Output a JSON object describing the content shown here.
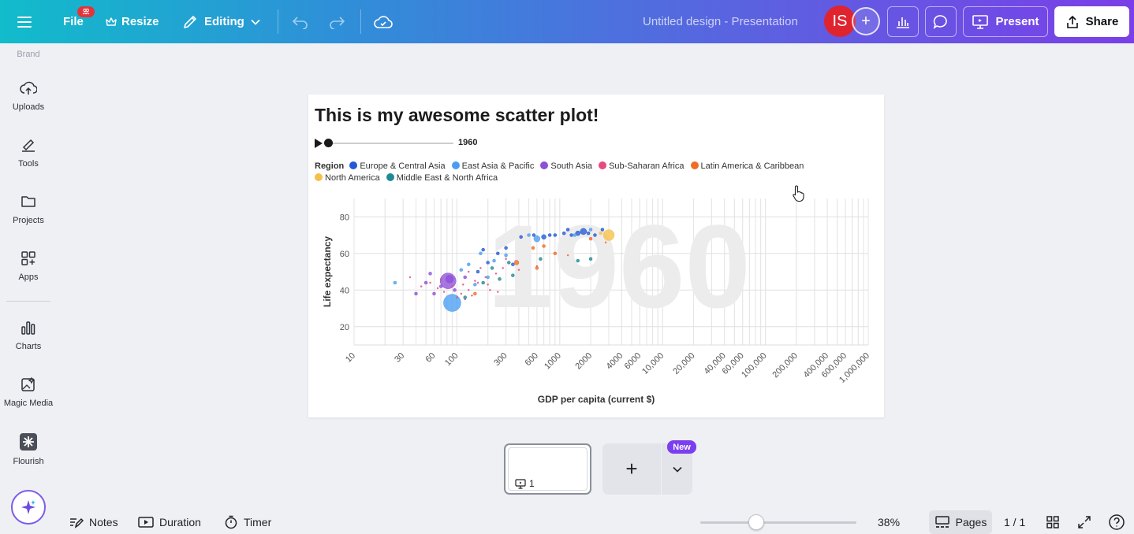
{
  "topbar": {
    "file_label": "File",
    "file_badge": "",
    "resize_label": "Resize",
    "editing_label": "Editing",
    "doc_title": "Untitled design - Presentation",
    "avatar_initials": "IS",
    "present_label": "Present",
    "share_label": "Share"
  },
  "rail": {
    "brand_label": "Brand",
    "items": [
      {
        "label": "Uploads",
        "icon": "cloud-upload-icon"
      },
      {
        "label": "Tools",
        "icon": "pen-tool-icon"
      },
      {
        "label": "Projects",
        "icon": "folder-icon"
      },
      {
        "label": "Apps",
        "icon": "apps-grid-icon"
      },
      {
        "label": "Charts",
        "icon": "bar-chart-icon"
      },
      {
        "label": "Magic Media",
        "icon": "magic-media-icon"
      },
      {
        "label": "Flourish",
        "icon": "flourish-icon"
      }
    ]
  },
  "slide": {
    "title": "This is my awesome scatter plot!",
    "year": "1960"
  },
  "chart_data": {
    "type": "scatter",
    "title": "This is my awesome scatter plot!",
    "xlabel": "GDP per capita (current $)",
    "ylabel": "Life expectancy",
    "x_scale": "log",
    "xlim": [
      10,
      1000000
    ],
    "ylim": [
      10,
      90
    ],
    "x_ticks": [
      "10",
      "30",
      "60",
      "100",
      "300",
      "600",
      "1000",
      "2000",
      "4000",
      "6000",
      "10,000",
      "20,000",
      "40,000",
      "60,000",
      "100,000",
      "200,000",
      "400,000",
      "600,000",
      "1,000,000"
    ],
    "x_tick_values": [
      10,
      30,
      60,
      100,
      300,
      600,
      1000,
      2000,
      4000,
      6000,
      10000,
      20000,
      40000,
      60000,
      100000,
      200000,
      400000,
      600000,
      1000000
    ],
    "y_ticks": [
      20,
      40,
      60,
      80
    ],
    "watermark": "1960",
    "legend_title": "Region",
    "legend_position": "top-left",
    "grid": true,
    "series": [
      {
        "name": "Europe & Central Asia",
        "color": "#2358d6",
        "points": [
          [
            420,
            69,
            2
          ],
          [
            560,
            70,
            2
          ],
          [
            700,
            69,
            3
          ],
          [
            900,
            70,
            2
          ],
          [
            1100,
            71,
            2
          ],
          [
            1300,
            70,
            2
          ],
          [
            1500,
            71,
            3
          ],
          [
            1700,
            72,
            4
          ],
          [
            1900,
            71,
            2
          ],
          [
            2200,
            70,
            2
          ],
          [
            2600,
            73,
            2
          ],
          [
            1200,
            73,
            2
          ],
          [
            250,
            60,
            2
          ],
          [
            300,
            63,
            2
          ],
          [
            200,
            55,
            2
          ],
          [
            180,
            62,
            2
          ],
          [
            350,
            54,
            2
          ],
          [
            800,
            70,
            2
          ],
          [
            160,
            50,
            2
          ]
        ]
      },
      {
        "name": "East Asia & Pacific",
        "color": "#4a9df2",
        "points": [
          [
            90,
            33,
            11
          ],
          [
            25,
            44,
            2
          ],
          [
            110,
            51,
            2
          ],
          [
            150,
            43,
            2
          ],
          [
            200,
            47,
            2
          ],
          [
            230,
            56,
            2
          ],
          [
            300,
            59,
            2
          ],
          [
            600,
            68,
            4
          ],
          [
            500,
            70,
            2
          ],
          [
            130,
            54,
            2
          ],
          [
            1400,
            70,
            2
          ],
          [
            170,
            60,
            2
          ],
          [
            2000,
            73,
            2
          ]
        ]
      },
      {
        "name": "South Asia",
        "color": "#8d4fd8",
        "points": [
          [
            82,
            45,
            10
          ],
          [
            85,
            46,
            5
          ],
          [
            60,
            38,
            2
          ],
          [
            70,
            42,
            2
          ],
          [
            50,
            44,
            2
          ],
          [
            95,
            40,
            2
          ],
          [
            120,
            47,
            2
          ],
          [
            55,
            49,
            2
          ],
          [
            40,
            38,
            2
          ]
        ]
      },
      {
        "name": "Sub-Saharan Africa",
        "color": "#e8497e",
        "points": [
          [
            45,
            42,
            1
          ],
          [
            55,
            44,
            1
          ],
          [
            65,
            41,
            1
          ],
          [
            70,
            46,
            1
          ],
          [
            75,
            39,
            1
          ],
          [
            90,
            42,
            1
          ],
          [
            110,
            38,
            1
          ],
          [
            130,
            40,
            1
          ],
          [
            150,
            45,
            1
          ],
          [
            160,
            44,
            1
          ],
          [
            190,
            47,
            1
          ],
          [
            210,
            40,
            1
          ],
          [
            240,
            49,
            1
          ],
          [
            280,
            52,
            1
          ],
          [
            35,
            47,
            1
          ],
          [
            100,
            36,
            1
          ],
          [
            120,
            35,
            1
          ],
          [
            140,
            37,
            1
          ],
          [
            200,
            43,
            1
          ],
          [
            250,
            39,
            1
          ],
          [
            300,
            57,
            1
          ],
          [
            400,
            51,
            1
          ],
          [
            600,
            53,
            1
          ],
          [
            130,
            50,
            1
          ],
          [
            170,
            52,
            1
          ],
          [
            115,
            43,
            1
          ]
        ]
      },
      {
        "name": "Latin America & Caribbean",
        "color": "#ef6d24",
        "points": [
          [
            380,
            55,
            3
          ],
          [
            600,
            52,
            2
          ],
          [
            900,
            60,
            2
          ],
          [
            2000,
            68,
            2
          ],
          [
            550,
            63,
            2
          ],
          [
            700,
            64,
            2
          ],
          [
            1200,
            59,
            1
          ],
          [
            2800,
            66,
            1
          ],
          [
            150,
            38,
            2
          ]
        ]
      },
      {
        "name": "North America",
        "color": "#f5c04a",
        "points": [
          [
            3000,
            70,
            7
          ],
          [
            2500,
            71,
            2
          ]
        ]
      },
      {
        "name": "Middle East & North Africa",
        "color": "#1f8a91",
        "points": [
          [
            180,
            44,
            2
          ],
          [
            260,
            46,
            2
          ],
          [
            220,
            52,
            2
          ],
          [
            350,
            48,
            2
          ],
          [
            650,
            57,
            2
          ],
          [
            1500,
            56,
            2
          ],
          [
            2000,
            57,
            2
          ],
          [
            120,
            36,
            2
          ],
          [
            320,
            55,
            2
          ]
        ]
      }
    ]
  },
  "pages": {
    "page_number": "1",
    "new_badge": "New"
  },
  "bottombar": {
    "notes_label": "Notes",
    "duration_label": "Duration",
    "timer_label": "Timer",
    "zoom_value": 38,
    "zoom_label": "38%",
    "pages_label": "Pages",
    "page_counter": "1 / 1"
  }
}
